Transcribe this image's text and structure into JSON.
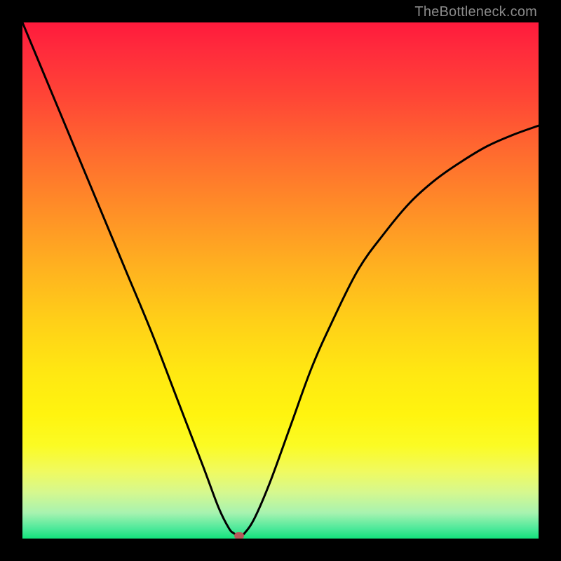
{
  "watermark": "TheBottleneck.com",
  "chart_data": {
    "type": "line",
    "title": "",
    "xlabel": "",
    "ylabel": "",
    "xlim": [
      0,
      100
    ],
    "ylim": [
      0,
      100
    ],
    "grid": false,
    "series": [
      {
        "name": "curve",
        "x": [
          0,
          5,
          10,
          15,
          20,
          25,
          30,
          35,
          38,
          40,
          41,
          42,
          43,
          45,
          48,
          52,
          56,
          60,
          65,
          70,
          75,
          80,
          85,
          90,
          95,
          100
        ],
        "y": [
          100,
          88,
          76,
          64,
          52,
          40,
          27,
          14,
          6,
          2,
          1,
          0.5,
          1,
          4,
          11,
          22,
          33,
          42,
          52,
          59,
          65,
          69.5,
          73,
          76,
          78.2,
          80
        ]
      }
    ],
    "marker": {
      "x": 42,
      "y": 0.5
    },
    "gradient": {
      "top": "#ff1a3c",
      "mid": "#ffd018",
      "bottom": "#13e37c"
    }
  }
}
